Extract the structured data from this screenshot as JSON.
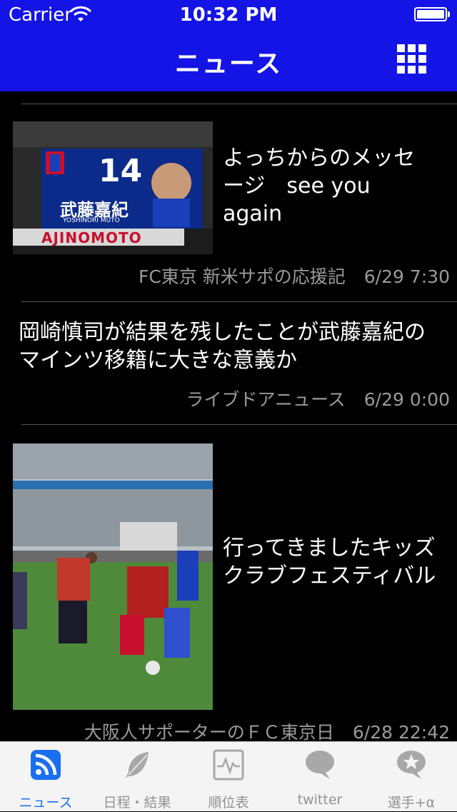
{
  "status_bar": {
    "carrier": "Carrier",
    "time": "10:32 PM"
  },
  "nav": {
    "title": "ニュース"
  },
  "news": [
    {
      "title": "よっちからのメッセージ　see you again",
      "source": "FC東京 新米サポの応援記",
      "date": "6/29 7:30",
      "thumb": {
        "number": "14",
        "name_jp": "武藤嘉紀",
        "name_en": "YOSHINORI MUTO",
        "sponsor": "AJINOMOTO"
      }
    },
    {
      "title": "岡崎慎司が結果を残したことが武藤嘉紀のマインツ移籍に大きな意義か",
      "source": "ライブドアニュース",
      "date": "6/29 0:00"
    },
    {
      "title": "行ってきましたキッズクラブフェスティバル",
      "source": "大阪人サポーターのＦＣ東京日",
      "date": "6/28 22:42"
    }
  ],
  "tabs": [
    {
      "label": "ニュース",
      "icon": "rss-icon",
      "active": true
    },
    {
      "label": "日程・結果",
      "icon": "feather-icon",
      "active": false
    },
    {
      "label": "順位表",
      "icon": "pulse-chart-icon",
      "active": false
    },
    {
      "label": "twitter",
      "icon": "speech-bubble-icon",
      "active": false
    },
    {
      "label": "選手+α",
      "icon": "star-bubble-icon",
      "active": false
    }
  ],
  "colors": {
    "header": "#1414e6",
    "tab_active": "#1a6ff0",
    "tab_inactive": "#929292"
  }
}
